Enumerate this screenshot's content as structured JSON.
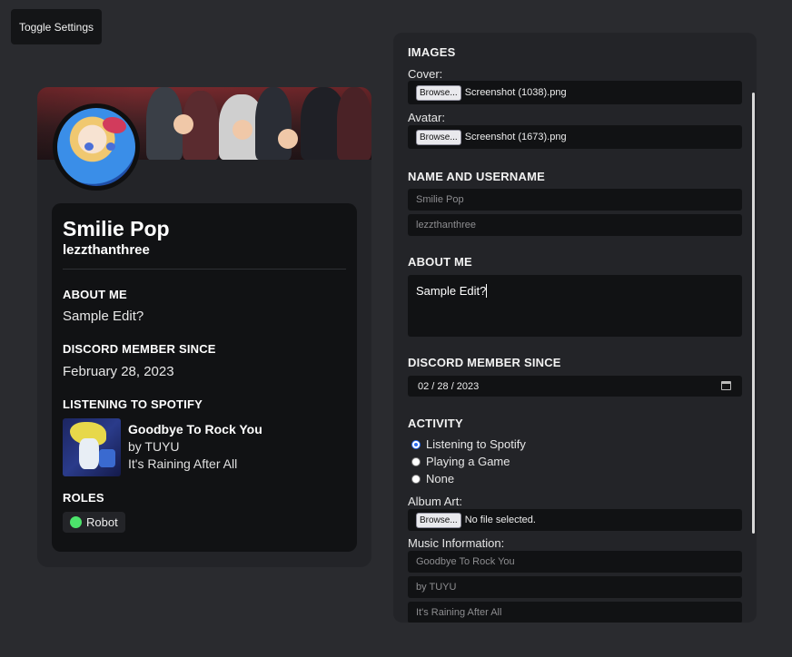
{
  "toggle_label": "Toggle Settings",
  "profile": {
    "display_name": "Smilie Pop",
    "username": "lezzthanthree",
    "about_title": "ABOUT ME",
    "about_text": "Sample Edit?",
    "member_title": "DISCORD MEMBER SINCE",
    "member_date": "February 28, 2023",
    "spotify_title": "LISTENING TO SPOTIFY",
    "track_title": "Goodbye To Rock You",
    "track_artist": "by TUYU",
    "track_album": "It's Raining After All",
    "roles_title": "ROLES",
    "role_name": "Robot",
    "role_color": "#4ce36b"
  },
  "settings": {
    "images_title": "IMAGES",
    "cover_label": "Cover:",
    "cover_button": "Browse...",
    "cover_file": "Screenshot (1038).png",
    "avatar_label": "Avatar:",
    "avatar_button": "Browse...",
    "avatar_file": "Screenshot (1673).png",
    "name_title": "NAME AND USERNAME",
    "name_value": "Smilie Pop",
    "username_value": "lezzthanthree",
    "about_title": "ABOUT ME",
    "about_value": "Sample Edit?",
    "member_title": "DISCORD MEMBER SINCE",
    "date_value": "02 / 28 / 2023",
    "activity_title": "ACTIVITY",
    "activity_options": [
      "Listening to Spotify",
      "Playing a Game",
      "None"
    ],
    "activity_selected": "Listening to Spotify",
    "album_label": "Album Art:",
    "album_button": "Browse...",
    "album_file": "No file selected.",
    "music_label": "Music Information:",
    "music_title": "Goodbye To Rock You",
    "music_artist": "by TUYU",
    "music_album": "It's Raining After All"
  },
  "colors": {
    "background": "#2a2b2f",
    "card": "#232428",
    "inner": "#111214",
    "accent": "#2a6cf0"
  }
}
